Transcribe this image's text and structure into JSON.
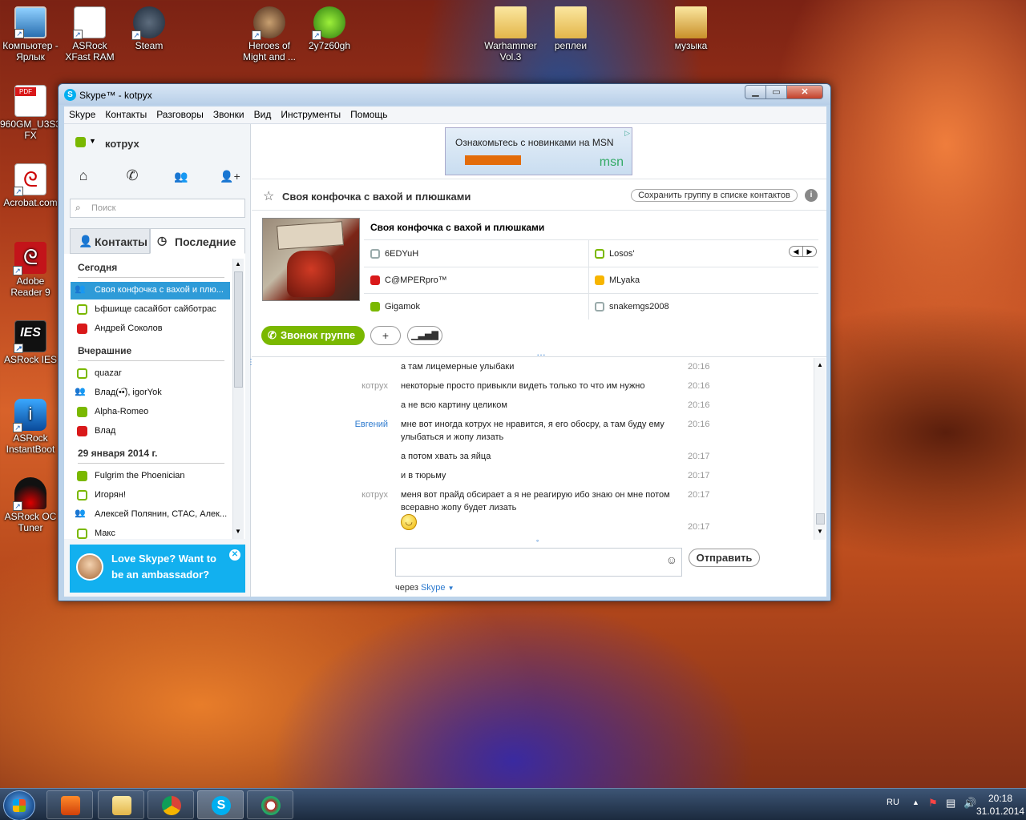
{
  "desktop": {
    "icons": [
      {
        "label": "Компьютер - Ярлык"
      },
      {
        "label": "ASRock XFast RAM"
      },
      {
        "label": "Steam"
      },
      {
        "label": "Heroes of Might and ..."
      },
      {
        "label": "2y7z60gh"
      },
      {
        "label": "Warhammer Vol.3"
      },
      {
        "label": "реплеи"
      },
      {
        "label": "музыка"
      },
      {
        "label": "960GM_U3S3 FX"
      },
      {
        "label": "Acrobat.com"
      },
      {
        "label": "Adobe Reader 9"
      },
      {
        "label": "ASRock IES"
      },
      {
        "label": "ASRock InstantBoot"
      },
      {
        "label": "ASRock OC Tuner"
      }
    ]
  },
  "window": {
    "title": "Skype™ - kotpyx",
    "menu": [
      "Skype",
      "Контакты",
      "Разговоры",
      "Звонки",
      "Вид",
      "Инструменты",
      "Помощь"
    ]
  },
  "sidebar": {
    "username": "котрух",
    "search_placeholder": "Поиск",
    "tabs": {
      "contacts": "Контакты",
      "recent": "Последние"
    },
    "sections": [
      {
        "title": "Сегодня"
      },
      {
        "title": "Вчерашние"
      },
      {
        "title": "29 января 2014 г."
      }
    ],
    "items": [
      {
        "label": "Своя конфочка с вахой и плю...",
        "status": "group"
      },
      {
        "label": "Ьфшище сасайбот сайботрас",
        "status": "online-outline"
      },
      {
        "label": "Андрей Соколов",
        "status": "busy"
      },
      {
        "label": "quazar",
        "status": "online-outline"
      },
      {
        "label": "Влад(•͡•), igorYok",
        "status": "group"
      },
      {
        "label": "Alpha-Romeo",
        "status": "online"
      },
      {
        "label": "Влад",
        "status": "busy"
      },
      {
        "label": "Fulgrim the Phoenician",
        "status": "online"
      },
      {
        "label": "Игорян!",
        "status": "online-outline"
      },
      {
        "label": "Алексей Полянин, СТАС, Алек...",
        "status": "group"
      },
      {
        "label": "Макс",
        "status": "online-outline"
      }
    ],
    "promo": {
      "line1": "Love Skype? Want to",
      "line2": "be an ambassador?"
    }
  },
  "ad": {
    "text": "Ознакомьтесь с новинками на MSN",
    "brand": "msn"
  },
  "chat": {
    "title": "Своя конфочка с вахой и плюшками",
    "save_group": "Сохранить группу в списке контактов",
    "group_name": "Своя конфочка с вахой и плюшками",
    "members": [
      {
        "name": "6EDYuH",
        "status": "unknown"
      },
      {
        "name": "Losos'",
        "status": "online-outline"
      },
      {
        "name": "C@MPERpro™",
        "status": "busy"
      },
      {
        "name": "MLyaka",
        "status": "away"
      },
      {
        "name": "Gigamok",
        "status": "online"
      },
      {
        "name": "snakemgs2008",
        "status": "unknown"
      }
    ],
    "call_group": "Звонок группе",
    "messages": [
      {
        "who": "",
        "text": "а там лицемерные улыбаки",
        "time": "20:16"
      },
      {
        "who": "котрух",
        "text": "некоторые просто привыкли видеть только то что им нужно",
        "time": "20:16"
      },
      {
        "who": "",
        "text": "а не всю картину целиком",
        "time": "20:16"
      },
      {
        "who": "Евгений",
        "text": "мне вот иногда котрух не нравится, я его обосру, а там буду ему улыбаться и жопу лизать",
        "time": "20:16"
      },
      {
        "who": "",
        "text": "а потом хвать за яйца",
        "time": "20:17"
      },
      {
        "who": "",
        "text": "и в тюрьму",
        "time": "20:17"
      },
      {
        "who": "котрух",
        "text": "меня вот прайд обсирает а я не реагирую ибо знаю он мне потом всеравно жопу будет лизать",
        "time": "20:17"
      },
      {
        "who": "",
        "text": "",
        "time": "20:17"
      }
    ],
    "send": "Отправить",
    "via": "через",
    "via_link": "Skype"
  },
  "taskbar": {
    "lang": "RU",
    "time": "20:18",
    "date": "31.01.2014"
  }
}
